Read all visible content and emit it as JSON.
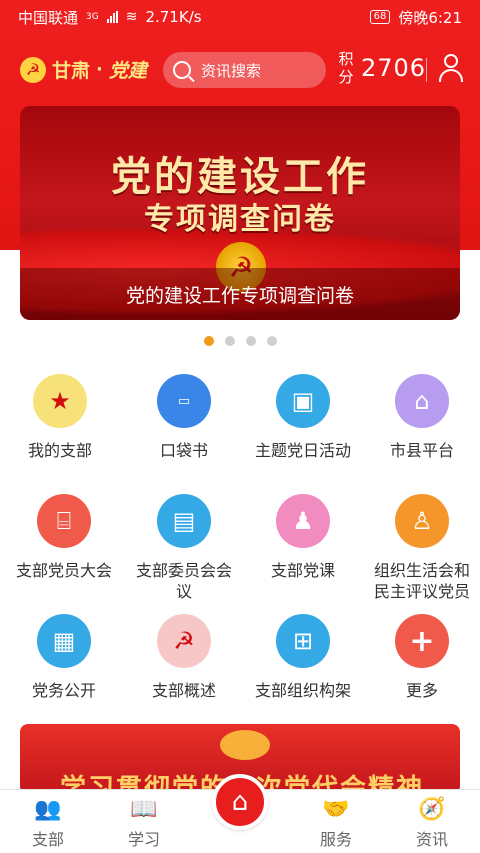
{
  "status_bar": {
    "carrier": "中国联通",
    "net_type": "3G",
    "speed": "2.71K/s",
    "battery": "68",
    "time": "傍晚6:21"
  },
  "header": {
    "brand_part1": "甘肃",
    "brand_sep": "·",
    "brand_part2": "党建",
    "search_placeholder": "资讯搜索",
    "points_label": "积分",
    "points_value": "2706"
  },
  "banner": {
    "headline": "党的建设工作",
    "subheadline": "专项调查问卷",
    "caption": "党的建设工作专项调查问卷",
    "dots_total": 4,
    "active_dot": 0
  },
  "grid": {
    "items": [
      {
        "label": "我的支部",
        "icon": "party-star-icon",
        "color": "#f7e27a"
      },
      {
        "label": "口袋书",
        "icon": "pocket-book-icon",
        "color": "#3a86e8"
      },
      {
        "label": "主题党日活动",
        "icon": "meeting-screen-icon",
        "color": "#35a8e6"
      },
      {
        "label": "市县平台",
        "icon": "building-icon",
        "color": "#b79cf0"
      },
      {
        "label": "支部党员大会",
        "icon": "hall-icon",
        "color": "#f05a4b"
      },
      {
        "label": "支部委员会会议",
        "icon": "board-icon",
        "color": "#35a8e6"
      },
      {
        "label": "支部党课",
        "icon": "teacher-icon",
        "color": "#f28bc0"
      },
      {
        "label": "组织生活会和民主评议党员",
        "icon": "speaker-icon",
        "color": "#f5962a"
      },
      {
        "label": "党务公开",
        "icon": "document-icon",
        "color": "#35a8e6"
      },
      {
        "label": "支部概述",
        "icon": "party-emblem-icon",
        "color": "#f7c7c7"
      },
      {
        "label": "支部组织构架",
        "icon": "org-chart-icon",
        "color": "#35a8e6"
      },
      {
        "label": "更多",
        "icon": "plus-icon",
        "color": "#f05a4b"
      }
    ]
  },
  "banner2": {
    "text": "学习贯彻党的…次党代会精神"
  },
  "tabbar": {
    "tabs": [
      {
        "label": "支部",
        "icon": "people-icon"
      },
      {
        "label": "学习",
        "icon": "book-icon"
      },
      {
        "label": "",
        "icon": "home-icon"
      },
      {
        "label": "服务",
        "icon": "handshake-icon"
      },
      {
        "label": "资讯",
        "icon": "compass-icon"
      }
    ]
  }
}
